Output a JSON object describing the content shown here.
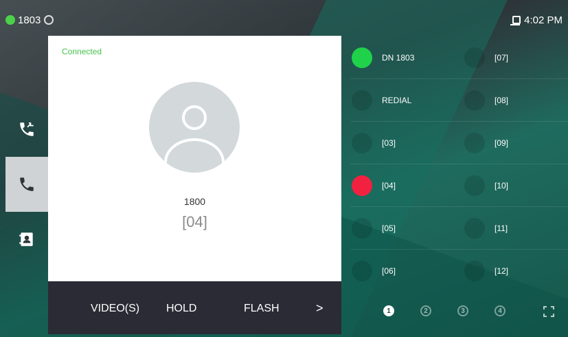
{
  "status_bar": {
    "account": "1803",
    "time": "4:02 PM"
  },
  "side_tabs": [
    "call-history",
    "active-call",
    "contacts"
  ],
  "call": {
    "state": "Connected",
    "number": "1800",
    "line": "[04]"
  },
  "softkeys": [
    "VIDEO(S)",
    "HOLD",
    "FLASH",
    ">"
  ],
  "line_keys": [
    {
      "label": "DN 1803",
      "status": "green"
    },
    {
      "label": "REDIAL",
      "status": "none"
    },
    {
      "label": "[03]",
      "status": "none"
    },
    {
      "label": "[04]",
      "status": "red"
    },
    {
      "label": "[05]",
      "status": "none"
    },
    {
      "label": "[06]",
      "status": "none"
    },
    {
      "label": "[07]",
      "status": "none"
    },
    {
      "label": "[08]",
      "status": "none"
    },
    {
      "label": "[09]",
      "status": "none"
    },
    {
      "label": "[10]",
      "status": "none"
    },
    {
      "label": "[11]",
      "status": "none"
    },
    {
      "label": "[12]",
      "status": "none"
    }
  ],
  "pages": [
    "1",
    "2",
    "3",
    "4"
  ],
  "colors": {
    "connected": "#46c24a",
    "line_active": "#20d24a",
    "line_alert": "#f2213f",
    "softkey_bar": "#2a2b35"
  }
}
